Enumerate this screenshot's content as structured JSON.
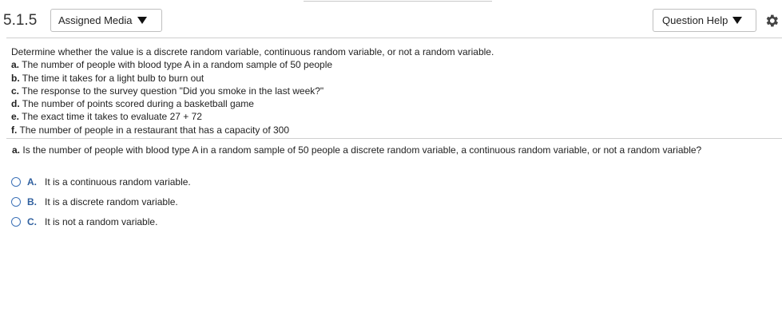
{
  "header": {
    "question_number": "5.1.5",
    "assigned_media_label": "Assigned Media",
    "question_help_label": "Question Help"
  },
  "problem": {
    "intro": "Determine whether the value is a discrete random variable, continuous random variable, or not a random variable.",
    "items": [
      {
        "letter": "a.",
        "text": "The number of people with blood type A in a random sample of 50 people"
      },
      {
        "letter": "b.",
        "text": "The time it takes for a light bulb to burn out"
      },
      {
        "letter": "c.",
        "text": "The response to the survey question \"Did you smoke in the last week?\""
      },
      {
        "letter": "d.",
        "text": "The number of points scored during a basketball game"
      },
      {
        "letter": "e.",
        "text": "The exact time it takes to evaluate 27 + 72"
      },
      {
        "letter": "f.",
        "text": "The number of people in a restaurant that has a capacity of 300"
      }
    ]
  },
  "question": {
    "letter": "a.",
    "text": "Is the number of people with blood type A in a random sample of 50 people a discrete random variable, a continuous random variable, or not a random variable?"
  },
  "choices": [
    {
      "letter": "A.",
      "text": "It is a continuous random variable."
    },
    {
      "letter": "B.",
      "text": "It is a discrete random variable."
    },
    {
      "letter": "C.",
      "text": "It is not a random variable."
    }
  ],
  "colors": {
    "accent": "#2f5f9e",
    "radio_border": "#3d72b8",
    "divider": "#cfcfcf"
  },
  "icons": {
    "settings": "gear-icon",
    "dropdown": "caret-down-icon",
    "radio": "radio-unselected-icon"
  }
}
